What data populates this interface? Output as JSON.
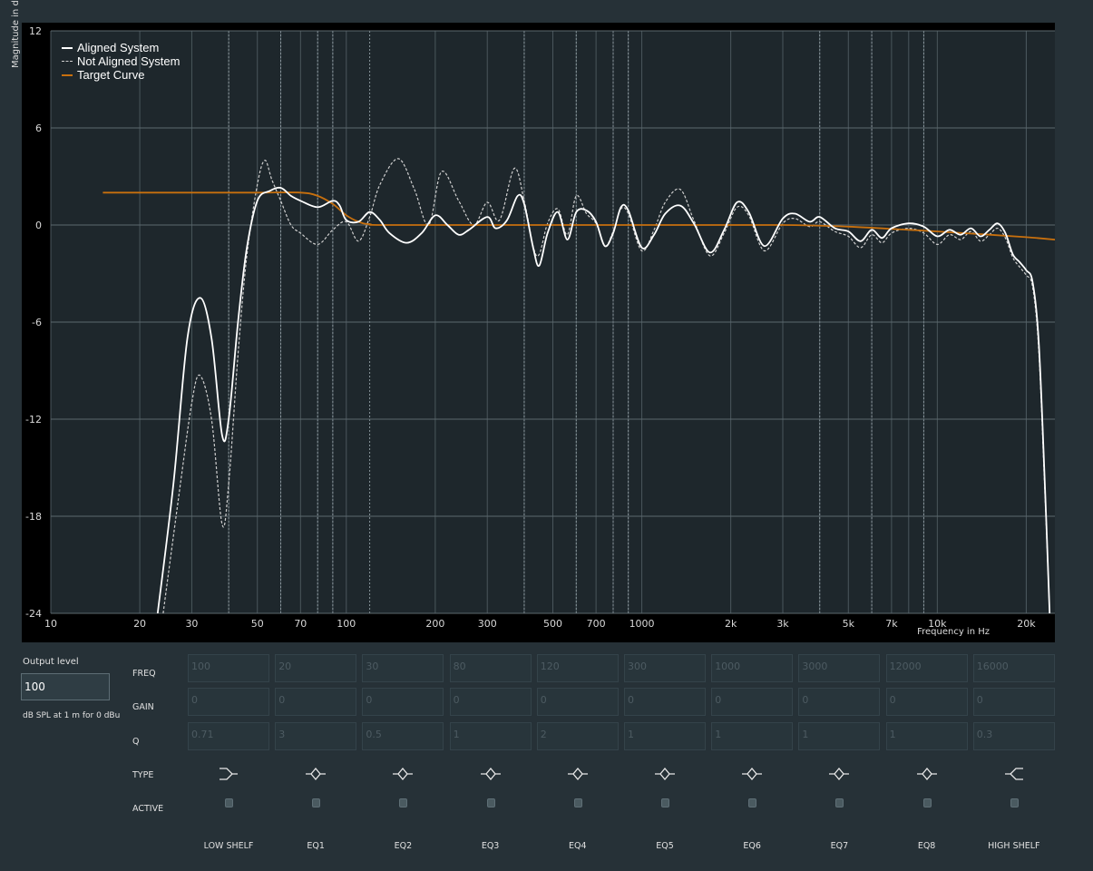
{
  "chart_data": {
    "type": "line",
    "title": "",
    "xlabel": "Frequency in Hz",
    "ylabel": "Magnitude in dB",
    "x_scale": "log",
    "xlim": [
      10,
      25000
    ],
    "ylim": [
      -24,
      12
    ],
    "grid": true,
    "legend_position": "top-left",
    "y_ticks": [
      12,
      6,
      0,
      -6,
      -12,
      -18,
      -24
    ],
    "x_ticks": [
      {
        "value": 10,
        "label": "10"
      },
      {
        "value": 20,
        "label": "20"
      },
      {
        "value": 30,
        "label": "30"
      },
      {
        "value": 50,
        "label": "50"
      },
      {
        "value": 70,
        "label": "70"
      },
      {
        "value": 100,
        "label": "100"
      },
      {
        "value": 200,
        "label": "200"
      },
      {
        "value": 300,
        "label": "300"
      },
      {
        "value": 500,
        "label": "500"
      },
      {
        "value": 700,
        "label": "700"
      },
      {
        "value": 1000,
        "label": "1000"
      },
      {
        "value": 2000,
        "label": "2k"
      },
      {
        "value": 3000,
        "label": "3k"
      },
      {
        "value": 5000,
        "label": "5k"
      },
      {
        "value": 7000,
        "label": "7k"
      },
      {
        "value": 10000,
        "label": "10k"
      },
      {
        "value": 20000,
        "label": "20k"
      }
    ],
    "marker_frequencies": [
      40,
      60,
      80,
      90,
      120,
      400,
      600,
      800,
      900,
      4000,
      6000,
      9000
    ],
    "series": [
      {
        "name": "Aligned System",
        "color": "#ffffff",
        "dashed": false,
        "points": [
          [
            23,
            -24
          ],
          [
            26,
            -16
          ],
          [
            29,
            -7
          ],
          [
            32,
            -4.5
          ],
          [
            35,
            -7
          ],
          [
            38,
            -13
          ],
          [
            40,
            -12
          ],
          [
            43,
            -6
          ],
          [
            46,
            -1.5
          ],
          [
            50,
            1.5
          ],
          [
            55,
            2.1
          ],
          [
            60,
            2.3
          ],
          [
            65,
            1.8
          ],
          [
            70,
            1.5
          ],
          [
            80,
            1.1
          ],
          [
            90,
            1.5
          ],
          [
            95,
            1.2
          ],
          [
            100,
            0.3
          ],
          [
            110,
            0.2
          ],
          [
            120,
            0.8
          ],
          [
            130,
            0.3
          ],
          [
            140,
            -0.5
          ],
          [
            160,
            -1.1
          ],
          [
            180,
            -0.5
          ],
          [
            200,
            0.6
          ],
          [
            220,
            0
          ],
          [
            240,
            -0.6
          ],
          [
            260,
            -0.3
          ],
          [
            300,
            0.5
          ],
          [
            320,
            -0.2
          ],
          [
            350,
            0.3
          ],
          [
            380,
            1.8
          ],
          [
            400,
            1.3
          ],
          [
            430,
            -1.5
          ],
          [
            450,
            -2.5
          ],
          [
            480,
            -0.5
          ],
          [
            520,
            0.8
          ],
          [
            560,
            -0.9
          ],
          [
            600,
            0.8
          ],
          [
            650,
            0.9
          ],
          [
            700,
            0.2
          ],
          [
            750,
            -1.3
          ],
          [
            800,
            -0.5
          ],
          [
            850,
            1.1
          ],
          [
            900,
            0.9
          ],
          [
            1000,
            -1.4
          ],
          [
            1100,
            -0.6
          ],
          [
            1200,
            0.7
          ],
          [
            1350,
            1.2
          ],
          [
            1500,
            0.1
          ],
          [
            1700,
            -1.7
          ],
          [
            1900,
            -0.3
          ],
          [
            2100,
            1.4
          ],
          [
            2300,
            0.8
          ],
          [
            2600,
            -1.3
          ],
          [
            3000,
            0.4
          ],
          [
            3300,
            0.7
          ],
          [
            3700,
            0.2
          ],
          [
            4000,
            0.5
          ],
          [
            4500,
            -0.2
          ],
          [
            5000,
            -0.4
          ],
          [
            5500,
            -1
          ],
          [
            6000,
            -0.3
          ],
          [
            6500,
            -0.8
          ],
          [
            7000,
            -0.2
          ],
          [
            8000,
            0.1
          ],
          [
            9000,
            -0.1
          ],
          [
            10000,
            -0.7
          ],
          [
            11000,
            -0.3
          ],
          [
            12000,
            -0.6
          ],
          [
            13000,
            -0.2
          ],
          [
            14000,
            -0.7
          ],
          [
            15000,
            -0.3
          ],
          [
            16000,
            0.1
          ],
          [
            17000,
            -0.5
          ],
          [
            18000,
            -1.8
          ],
          [
            19000,
            -2.3
          ],
          [
            20000,
            -2.8
          ],
          [
            21000,
            -3.5
          ],
          [
            22000,
            -7
          ],
          [
            23000,
            -15
          ],
          [
            24000,
            -24
          ]
        ]
      },
      {
        "name": "Not Aligned System",
        "color": "#cfcfcf",
        "dashed": true,
        "points": [
          [
            24,
            -24
          ],
          [
            27,
            -17
          ],
          [
            30,
            -11
          ],
          [
            32,
            -9.3
          ],
          [
            35,
            -12
          ],
          [
            38,
            -18.5
          ],
          [
            40,
            -16
          ],
          [
            43,
            -8
          ],
          [
            46,
            -2
          ],
          [
            50,
            2.5
          ],
          [
            53,
            4
          ],
          [
            56,
            2.8
          ],
          [
            60,
            1.5
          ],
          [
            65,
            0
          ],
          [
            70,
            -0.5
          ],
          [
            80,
            -1.2
          ],
          [
            90,
            -0.3
          ],
          [
            100,
            0.2
          ],
          [
            110,
            -1
          ],
          [
            120,
            0.5
          ],
          [
            130,
            2.5
          ],
          [
            150,
            4.1
          ],
          [
            170,
            2.2
          ],
          [
            190,
            0
          ],
          [
            210,
            3.3
          ],
          [
            240,
            1.5
          ],
          [
            270,
            0
          ],
          [
            300,
            1.4
          ],
          [
            330,
            0.3
          ],
          [
            370,
            3.5
          ],
          [
            400,
            1.5
          ],
          [
            430,
            -1.4
          ],
          [
            450,
            -1.8
          ],
          [
            480,
            0.1
          ],
          [
            520,
            1
          ],
          [
            560,
            -0.6
          ],
          [
            600,
            1.8
          ],
          [
            650,
            0.7
          ],
          [
            700,
            0.1
          ],
          [
            750,
            -1.3
          ],
          [
            800,
            -0.4
          ],
          [
            850,
            1
          ],
          [
            900,
            0.7
          ],
          [
            1000,
            -1.6
          ],
          [
            1100,
            -0.3
          ],
          [
            1200,
            1.4
          ],
          [
            1350,
            2.2
          ],
          [
            1500,
            0.3
          ],
          [
            1700,
            -1.9
          ],
          [
            1900,
            -0.5
          ],
          [
            2100,
            1.1
          ],
          [
            2300,
            0.6
          ],
          [
            2600,
            -1.6
          ],
          [
            3000,
            0.1
          ],
          [
            3300,
            0.4
          ],
          [
            3700,
            -0.1
          ],
          [
            4000,
            0.2
          ],
          [
            4500,
            -0.4
          ],
          [
            5000,
            -0.7
          ],
          [
            5500,
            -1.4
          ],
          [
            6000,
            -0.6
          ],
          [
            6500,
            -1.1
          ],
          [
            7000,
            -0.5
          ],
          [
            8000,
            -0.2
          ],
          [
            9000,
            -0.5
          ],
          [
            10000,
            -1.2
          ],
          [
            11000,
            -0.6
          ],
          [
            12000,
            -0.9
          ],
          [
            13000,
            -0.4
          ],
          [
            14000,
            -1
          ],
          [
            15000,
            -0.6
          ],
          [
            16000,
            -0.2
          ],
          [
            17000,
            -0.8
          ],
          [
            18000,
            -2
          ],
          [
            19000,
            -2.6
          ],
          [
            20000,
            -3.1
          ],
          [
            21000,
            -3.8
          ],
          [
            22000,
            -7.5
          ],
          [
            23000,
            -15.5
          ],
          [
            24000,
            -24
          ]
        ]
      },
      {
        "name": "Target Curve",
        "color": "#c8700e",
        "dashed": false,
        "points": [
          [
            15,
            2
          ],
          [
            30,
            2
          ],
          [
            50,
            2
          ],
          [
            70,
            2
          ],
          [
            80,
            1.8
          ],
          [
            90,
            1.3
          ],
          [
            100,
            0.6
          ],
          [
            110,
            0.2
          ],
          [
            120,
            0.05
          ],
          [
            150,
            0
          ],
          [
            1000,
            0
          ],
          [
            3000,
            0
          ],
          [
            5000,
            -0.1
          ],
          [
            8000,
            -0.3
          ],
          [
            10000,
            -0.4
          ],
          [
            15000,
            -0.6
          ],
          [
            20000,
            -0.75
          ],
          [
            25000,
            -0.9
          ]
        ]
      }
    ]
  },
  "controls": {
    "output_level_label": "Output level",
    "output_level_value": "100",
    "output_unit": "dB SPL at 1 m for 0 dBu",
    "row_labels": {
      "freq": "FREQ",
      "gain": "GAIN",
      "q": "Q",
      "type": "TYPE",
      "active": "ACTIVE"
    },
    "bands": [
      {
        "name": "LOW SHELF",
        "freq": "100",
        "gain": "0",
        "q": "0.71",
        "type": "low-shelf-icon"
      },
      {
        "name": "EQ1",
        "freq": "20",
        "gain": "0",
        "q": "3",
        "type": "peak-eq-icon"
      },
      {
        "name": "EQ2",
        "freq": "30",
        "gain": "0",
        "q": "0.5",
        "type": "peak-eq-icon"
      },
      {
        "name": "EQ3",
        "freq": "80",
        "gain": "0",
        "q": "1",
        "type": "peak-eq-icon"
      },
      {
        "name": "EQ4",
        "freq": "120",
        "gain": "0",
        "q": "2",
        "type": "peak-eq-icon"
      },
      {
        "name": "EQ5",
        "freq": "300",
        "gain": "0",
        "q": "1",
        "type": "peak-eq-icon"
      },
      {
        "name": "EQ6",
        "freq": "1000",
        "gain": "0",
        "q": "1",
        "type": "peak-eq-icon"
      },
      {
        "name": "EQ7",
        "freq": "3000",
        "gain": "0",
        "q": "1",
        "type": "peak-eq-icon"
      },
      {
        "name": "EQ8",
        "freq": "12000",
        "gain": "0",
        "q": "1",
        "type": "peak-eq-icon"
      },
      {
        "name": "HIGH SHELF",
        "freq": "16000",
        "gain": "0",
        "q": "0.3",
        "type": "high-shelf-icon"
      }
    ]
  }
}
